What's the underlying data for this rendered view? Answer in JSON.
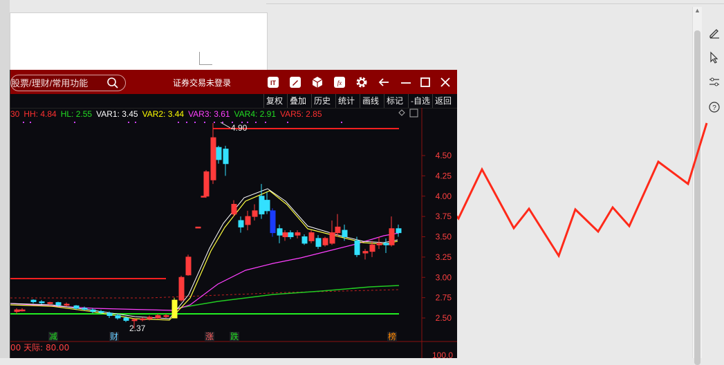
{
  "app": {
    "search_placeholder": "股票/理财/常用功能",
    "login_status": "证券交易未登录",
    "menu": [
      "复权",
      "叠加",
      "历史",
      "统计",
      "画线",
      "标记",
      "-自选",
      "返回"
    ],
    "indicators": [
      {
        "label": "30",
        "color": "#ff3030"
      },
      {
        "label": "HH: 4.84",
        "color": "#ff3030"
      },
      {
        "label": "HL: 2.55",
        "color": "#22dd22"
      },
      {
        "label": "VAR1: 3.45",
        "color": "#ffffff"
      },
      {
        "label": "VAR2: 3.44",
        "color": "#ffff00"
      },
      {
        "label": "VAR3: 3.61",
        "color": "#ff40ff"
      },
      {
        "label": "VAR4: 2.91",
        "color": "#22dd22"
      },
      {
        "label": "VAR5: 2.85",
        "color": "#ff3030"
      }
    ],
    "price_axis": [
      "4.50",
      "4.25",
      "4.00",
      "3.75",
      "3.50",
      "3.25",
      "3.00",
      "2.75",
      "2.50"
    ],
    "bottom_axis_label": "100.0",
    "high_label": "4.90",
    "low_label": "2.37",
    "event_markers": [
      {
        "text": "减",
        "color": "#22dd22"
      },
      {
        "text": "财",
        "color": "#66ccff"
      },
      {
        "text": "涨",
        "color": "#ff6060"
      },
      {
        "text": "跌",
        "color": "#22dd22"
      },
      {
        "text": "榜",
        "color": "#ff8800"
      }
    ],
    "sub_indicator": "00  天际: 80.00",
    "colors": {
      "title_bg": "#8a0000",
      "up": "#ff3b3b",
      "down": "#33e0ff",
      "bg": "#0b0b10"
    }
  },
  "host_tools": [
    "edit-pen-icon",
    "pointer-icon",
    "sliders-icon",
    "help-icon"
  ]
}
